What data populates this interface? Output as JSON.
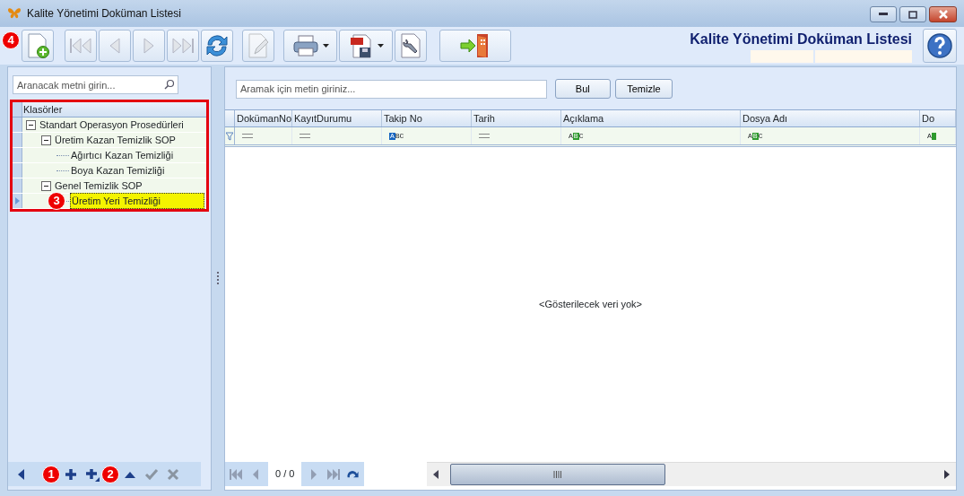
{
  "window": {
    "title": "Kalite Yönetimi Doküman Listesi"
  },
  "toolbar": [
    {
      "kind": "new",
      "disabled": false,
      "marker": "4"
    },
    {
      "kind": "first",
      "disabled": true
    },
    {
      "kind": "prev",
      "disabled": true
    },
    {
      "kind": "next",
      "disabled": true
    },
    {
      "kind": "last",
      "disabled": true
    },
    {
      "kind": "refresh",
      "disabled": false
    },
    {
      "kind": "edit",
      "disabled": true
    },
    {
      "kind": "print",
      "disabled": false,
      "dropdown": true
    },
    {
      "kind": "pdf",
      "disabled": false,
      "dropdown": true
    },
    {
      "kind": "settings",
      "disabled": false
    },
    {
      "kind": "exit",
      "disabled": false
    }
  ],
  "header_title": "Kalite Yönetimi Doküman Listesi",
  "tree_panel": {
    "search": {
      "placeholder": "Aranacak metni girin..."
    },
    "column": "Klasörler",
    "nodes": [
      {
        "label": "Standart Operasyon Prosedürleri",
        "expanded": true,
        "selected": false,
        "children": [
          {
            "label": "Üretim Kazan Temizlik SOP",
            "expanded": true,
            "selected": false,
            "children": [
              {
                "label": "Ağırtıcı Kazan Temizliği",
                "selected": false
              },
              {
                "label": "Boya Kazan Temizliği",
                "selected": false
              }
            ]
          },
          {
            "label": "Genel Temizlik SOP",
            "expanded": true,
            "selected": false,
            "children": [
              {
                "label": "Üretim Yeri Temizliği",
                "selected": true,
                "marker": "3"
              }
            ]
          }
        ]
      }
    ],
    "navigator": [
      {
        "kind": "back",
        "disabled": false
      },
      {
        "kind": "add",
        "disabled": false,
        "marker": "1"
      },
      {
        "kind": "add-child",
        "disabled": false,
        "marker": "2"
      },
      {
        "kind": "up",
        "disabled": false
      },
      {
        "kind": "check",
        "disabled": true
      },
      {
        "kind": "cancel",
        "disabled": true
      }
    ]
  },
  "grid_panel": {
    "search": {
      "placeholder": "Aramak için metin giriniz..."
    },
    "buttons": [
      "Bul",
      "Temizle"
    ],
    "columns": [
      {
        "title": "DokümanNo",
        "filter": {
          "kind": "equals"
        }
      },
      {
        "title": "KayıtDurumu",
        "filter": {
          "kind": "equals"
        }
      },
      {
        "title": "Takip No",
        "filter": {
          "kind": "text",
          "highlighted": "A",
          "label_after": "BC",
          "color": "#1565c0"
        }
      },
      {
        "title": "Tarih",
        "filter": {
          "kind": "equals"
        }
      },
      {
        "title": "Açıklama",
        "filter": {
          "kind": "text",
          "label_before": "A",
          "highlighted": "B",
          "label_after": "C",
          "color": "#2e9a2e"
        }
      },
      {
        "title": "Dosya Adı",
        "filter": {
          "kind": "text",
          "label_before": "A",
          "highlighted": "B",
          "label_after": "C",
          "color": "#2e9a2e"
        }
      },
      {
        "title": "Do",
        "filter": {
          "kind": "text",
          "label_before": "A",
          "color": "#2e9a2e"
        }
      }
    ],
    "empty_text": "<Gösterilecek veri yok>",
    "pager": {
      "first_disabled": true,
      "prev_disabled": true,
      "position": "0 / 0",
      "next_disabled": true,
      "last_disabled": true
    }
  }
}
